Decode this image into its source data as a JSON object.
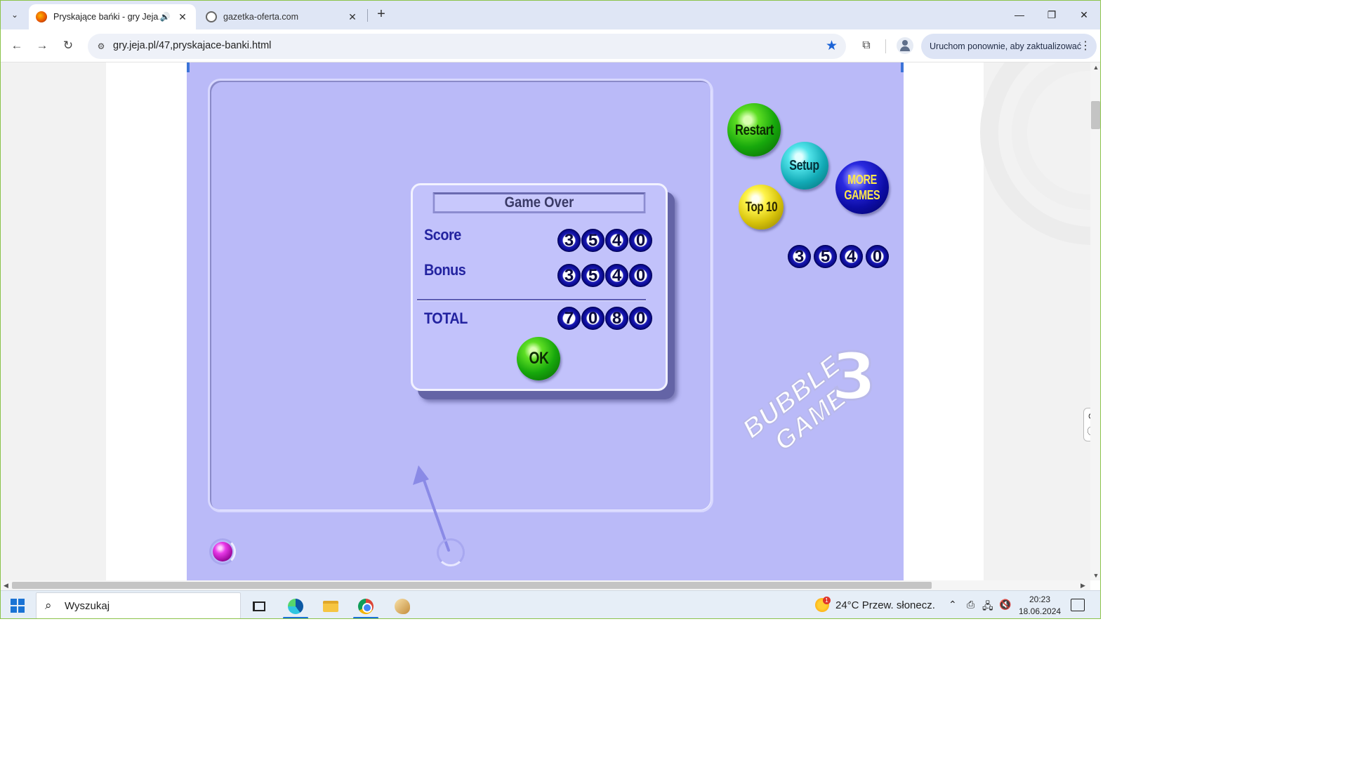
{
  "browser": {
    "tabs": [
      {
        "title": "Pryskające bańki - gry Jeja.p",
        "active": true,
        "audio": true
      },
      {
        "title": "gazetka-oferta.com",
        "active": false
      }
    ],
    "url": "gry.jeja.pl/47,pryskajace-banki.html",
    "update_button": "Uruchom ponownie, aby zaktualizować",
    "bookmarked": true,
    "accent": "#1a62d6"
  },
  "game": {
    "menu": {
      "restart": "Restart",
      "setup": "Setup",
      "top10": "Top 10",
      "more_games_line1": "MORE",
      "more_games_line2": "GAMES"
    },
    "current_score_digits": [
      "3",
      "5",
      "4",
      "0"
    ],
    "dialog": {
      "title": "Game Over",
      "score_label": "Score",
      "score_digits": [
        "3",
        "5",
        "4",
        "0"
      ],
      "bonus_label": "Bonus",
      "bonus_digits": [
        "3",
        "5",
        "4",
        "0"
      ],
      "total_label": "TOTAL",
      "total_digits": [
        "7",
        "0",
        "8",
        "0"
      ],
      "ok": "OK"
    },
    "logo": {
      "word1": "BUBBLE",
      "word2": "GAME",
      "number": "3"
    },
    "colors": {
      "background": "#babaf8",
      "label": "#2323a0"
    }
  },
  "taskbar": {
    "search_placeholder": "Wyszukaj",
    "weather_temp": "24°C",
    "weather_desc": "Przew. słonecz.",
    "weather_badge": "1",
    "time": "20:23",
    "date": "18.06.2024"
  }
}
